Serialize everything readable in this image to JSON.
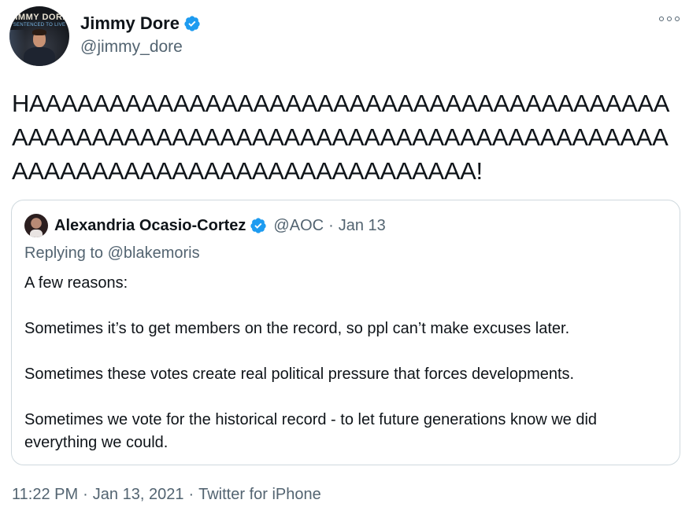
{
  "author": {
    "display_name": "Jimmy Dore",
    "handle": "@jimmy_dore",
    "avatar_text_line1": "JIMMY DORE",
    "avatar_text_line2": "SENTENCED TO LIVE"
  },
  "tweet": {
    "text": "HAAAAAAAAAAAAAAAAAAAAAAAAAAAAAAAAAAAAAAAAAAAAAAAAAAAAAAAAAAAAAAAAAAAAAAAAAAAAAAAAAAAAAAAAAAAAAAAAAAAAAAAAAAAAAA!"
  },
  "quote": {
    "display_name": "Alexandria Ocasio-Cortez",
    "handle": "@AOC",
    "separator": "·",
    "date": "Jan 13",
    "replying_to": "Replying to @blakemoris",
    "paragraphs": [
      "A few reasons:",
      "Sometimes it’s to get members on the record, so ppl can’t make excuses later.",
      "Sometimes these votes create real political pressure that forces developments.",
      "Sometimes we vote for the historical record - to let future generations know we did everything we could."
    ]
  },
  "footer": {
    "time": "11:22 PM",
    "date": "Jan 13, 2021",
    "source": "Twitter for iPhone",
    "separator": "·"
  },
  "icons": {
    "verified": "verified-badge-icon",
    "more": "more-options-icon"
  },
  "colors": {
    "verified_blue": "#1d9bf0",
    "secondary_text": "#536471",
    "border": "#cfd9de"
  }
}
